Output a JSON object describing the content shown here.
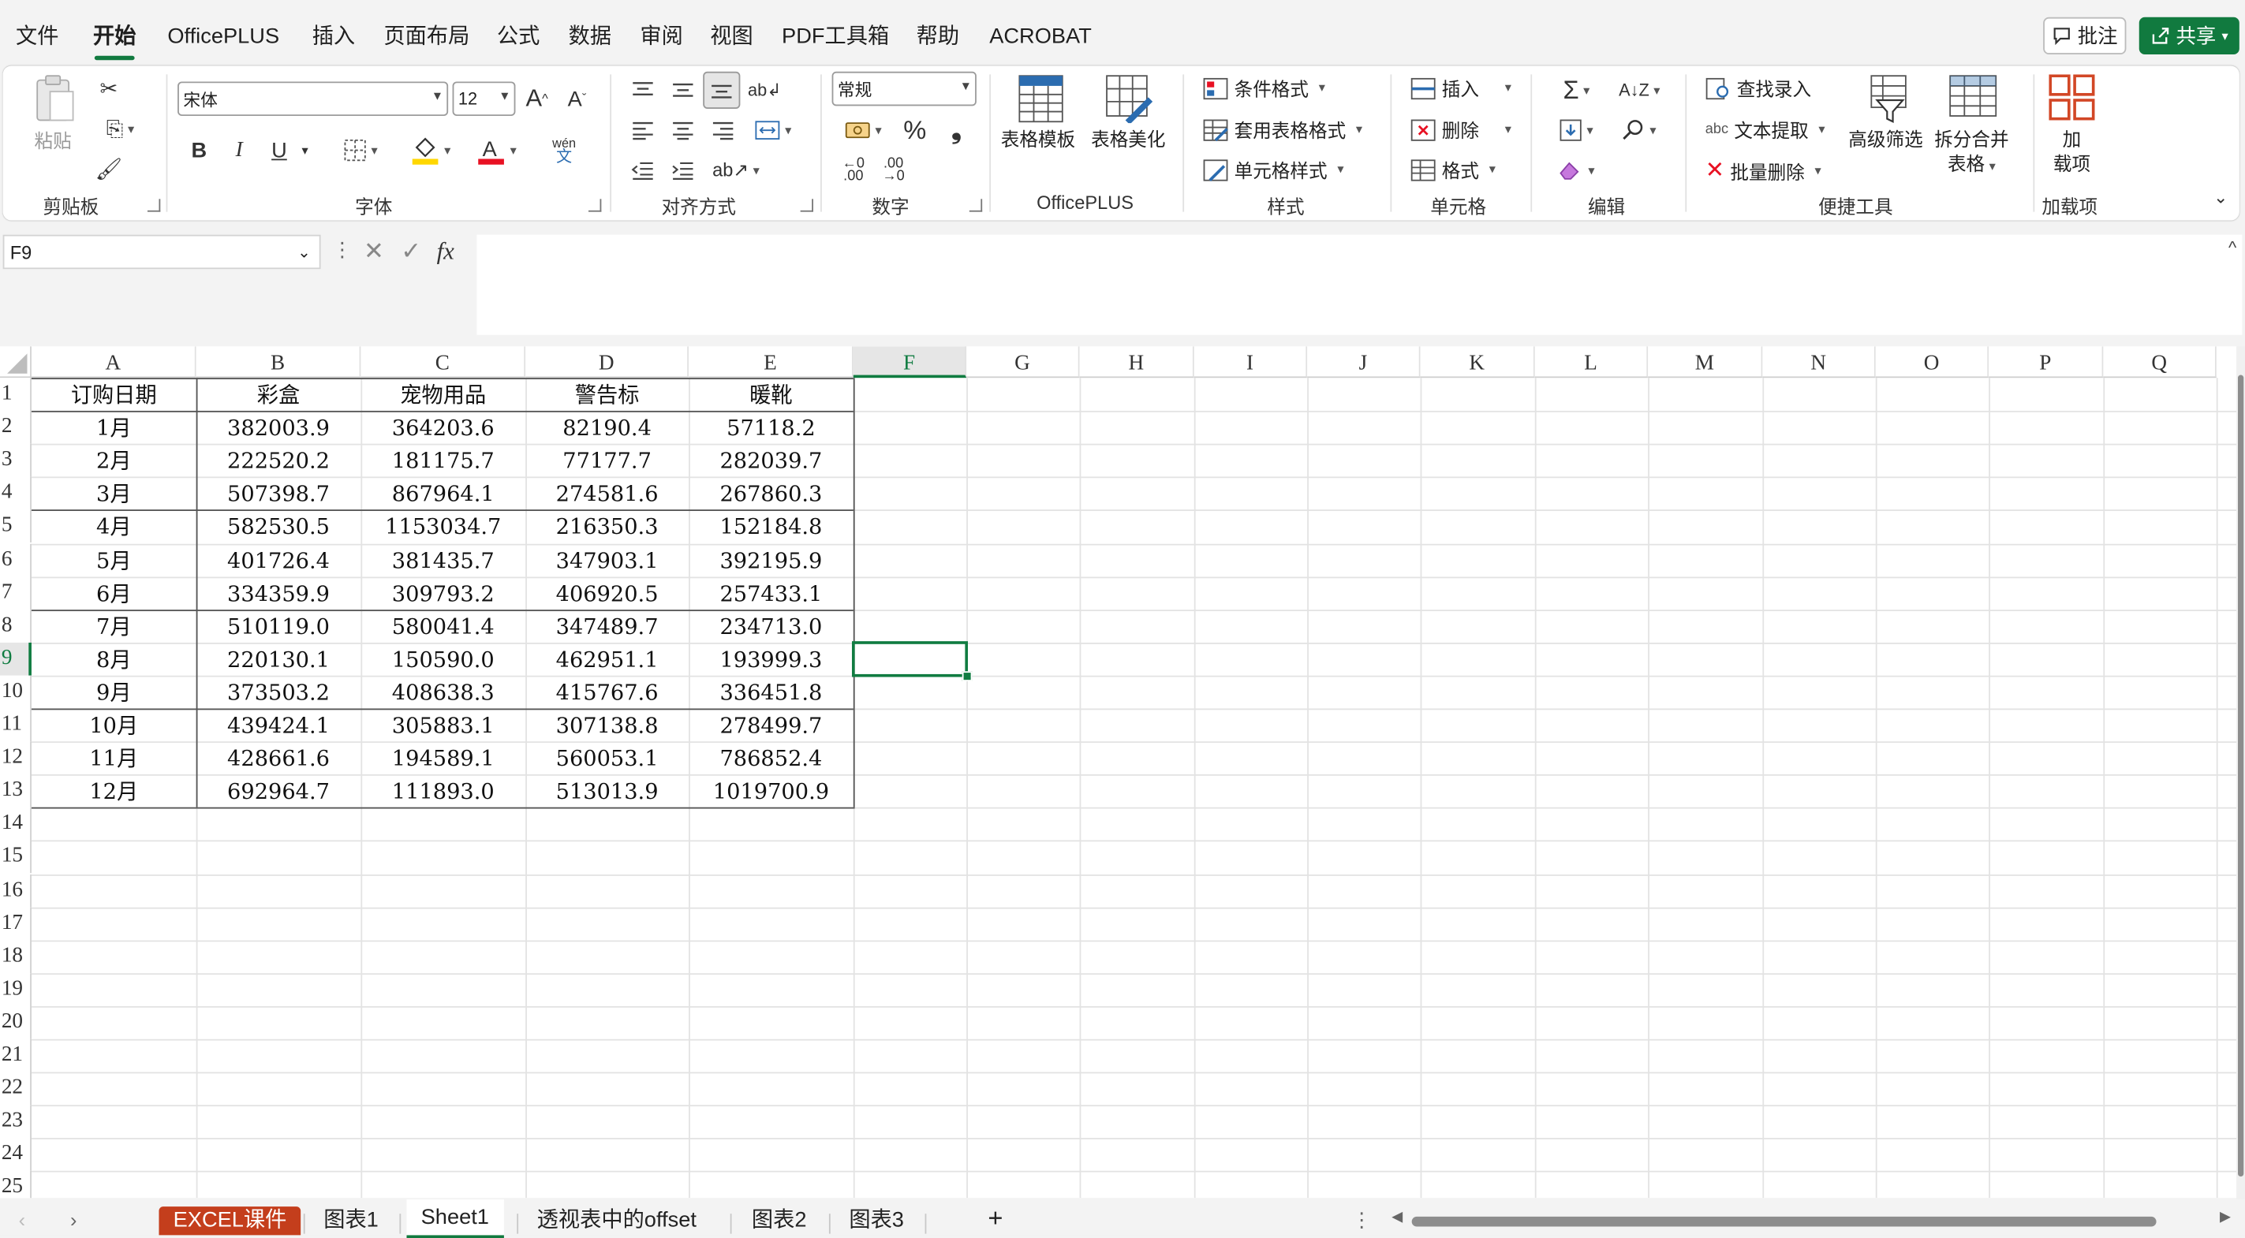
{
  "menu": {
    "items": [
      "文件",
      "开始",
      "OfficePLUS",
      "插入",
      "页面布局",
      "公式",
      "数据",
      "审阅",
      "视图",
      "PDF工具箱",
      "帮助",
      "ACROBAT"
    ],
    "active": "开始",
    "comment_label": "批注",
    "share_label": "共享"
  },
  "ribbon": {
    "clipboard": {
      "group": "剪贴板",
      "paste": "粘贴"
    },
    "font": {
      "group": "字体",
      "font_name": "宋体",
      "font_size": "12",
      "grow": "A^",
      "shrink": "Aˇ",
      "bold": "B",
      "italic": "I",
      "underline": "U",
      "phonetic_top": "wén",
      "phonetic_bottom": "文"
    },
    "alignment": {
      "group": "对齐方式"
    },
    "number": {
      "group": "数字",
      "format": "常规",
      "percent": "%",
      "comma": "❟",
      "inc_decimal": ".00",
      "dec_decimal": ".00"
    },
    "officeplus": {
      "group": "OfficePLUS",
      "table_template": "表格模板",
      "table_beautify": "表格美化"
    },
    "styles": {
      "group": "样式",
      "conditional": "条件格式",
      "table_format": "套用表格格式",
      "cell_style": "单元格样式"
    },
    "cells": {
      "group": "单元格",
      "insert": "插入",
      "delete": "删除",
      "format": "格式"
    },
    "editing": {
      "group": "编辑"
    },
    "quick_tools": {
      "group": "便捷工具",
      "find_entry": "查找录入",
      "text_extract": "文本提取",
      "batch_delete": "批量删除",
      "adv_filter": "高级筛选",
      "split_merge_1": "拆分合并",
      "split_merge_2": "表格"
    },
    "addins": {
      "group": "加载项",
      "addin_1": "加",
      "addin_2": "载项"
    }
  },
  "formula_bar": {
    "name_box": "F9",
    "cancel": "✕",
    "enter": "✓",
    "fx": "fx",
    "content": ""
  },
  "sheet": {
    "columns": [
      "A",
      "B",
      "C",
      "D",
      "E",
      "F",
      "G",
      "H",
      "I",
      "J",
      "K",
      "L",
      "M",
      "N",
      "O",
      "P",
      "Q"
    ],
    "selected_column": "F",
    "row_numbers": [
      "1",
      "2",
      "3",
      "4",
      "5",
      "6",
      "7",
      "8",
      "9",
      "10",
      "11",
      "12",
      "13",
      "14",
      "15",
      "16",
      "17",
      "18",
      "19",
      "20",
      "21",
      "22",
      "23",
      "24",
      "25"
    ],
    "selected_row": "9",
    "selected_cell": "F9",
    "headers": [
      "订购日期",
      "彩盒",
      "宠物用品",
      "警告标",
      "暖靴"
    ],
    "rows": [
      [
        "1月",
        "382003.9",
        "364203.6",
        "82190.4",
        "57118.2"
      ],
      [
        "2月",
        "222520.2",
        "181175.7",
        "77177.7",
        "282039.7"
      ],
      [
        "3月",
        "507398.7",
        "867964.1",
        "274581.6",
        "267860.3"
      ],
      [
        "4月",
        "582530.5",
        "1153034.7",
        "216350.3",
        "152184.8"
      ],
      [
        "5月",
        "401726.4",
        "381435.7",
        "347903.1",
        "392195.9"
      ],
      [
        "6月",
        "334359.9",
        "309793.2",
        "406920.5",
        "257433.1"
      ],
      [
        "7月",
        "510119.0",
        "580041.4",
        "347489.7",
        "234713.0"
      ],
      [
        "8月",
        "220130.1",
        "150590.0",
        "462951.1",
        "193999.3"
      ],
      [
        "9月",
        "373503.2",
        "408638.3",
        "415767.6",
        "336451.8"
      ],
      [
        "10月",
        "439424.1",
        "305883.1",
        "307138.8",
        "278499.7"
      ],
      [
        "11月",
        "428661.6",
        "194589.1",
        "560053.1",
        "786852.4"
      ],
      [
        "12月",
        "692964.7",
        "111893.0",
        "513013.9",
        "1019700.9"
      ]
    ]
  },
  "tabs": {
    "items": [
      "EXCEL课件",
      "图表1",
      "Sheet1",
      "透视表中的offset",
      "图表2",
      "图表3"
    ],
    "active": "Sheet1",
    "add": "+"
  },
  "colors": {
    "accent": "#117a3f",
    "tab_highlight": "#c43e1c",
    "font_color_bar": "#e81123",
    "fill_color_bar": "#ffd700"
  }
}
